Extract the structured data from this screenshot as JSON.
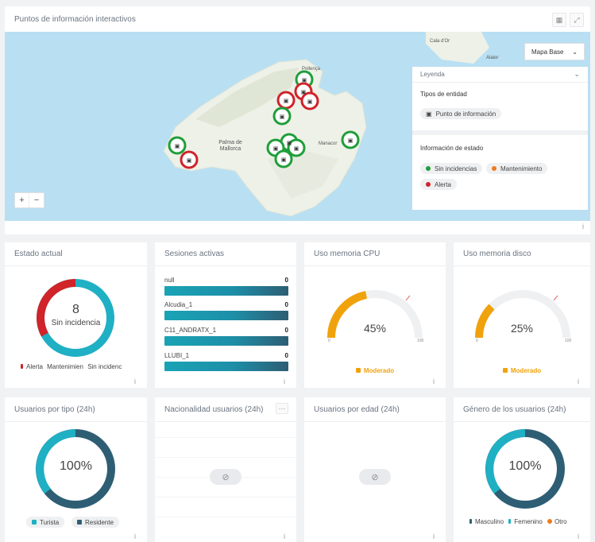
{
  "map_panel": {
    "title": "Puntos de información interactivos",
    "basemap_button": "Mapa Base",
    "zoom_in": "+",
    "zoom_out": "−",
    "info": "i",
    "place_labels": [
      "Cala d'Or",
      "Alaior",
      "Palma de Mallorca",
      "Manacor",
      "Pollença"
    ],
    "legend": {
      "title": "Leyenda",
      "entity_section": "Tipos de entidad",
      "entity_chip": "Punto de información",
      "state_section": "Información de estado",
      "states": [
        {
          "label": "Sin incidencias",
          "color": "#1f9e3a"
        },
        {
          "label": "Mantenimiento",
          "color": "#f07b1c"
        },
        {
          "label": "Alerta",
          "color": "#d0232a"
        }
      ]
    }
  },
  "widgets": {
    "estado": {
      "title": "Estado actual",
      "value": "8",
      "label": "Sin incidencia",
      "legend": [
        "Alerta",
        "Mantenimien",
        "Sin incidenc"
      ],
      "info": "i",
      "slices": [
        {
          "label": "Alerta",
          "fraction": 0.33,
          "color": "#d0232a"
        },
        {
          "label": "Sin incidencias",
          "fraction": 0.67,
          "color": "#1fb0c4"
        }
      ]
    },
    "sesiones": {
      "title": "Sesiones activas",
      "info": "i",
      "rows": [
        {
          "label": "null",
          "value": "0"
        },
        {
          "label": "Alcudia_1",
          "value": "0"
        },
        {
          "label": "C11_ANDRATX_1",
          "value": "0"
        },
        {
          "label": "LLUBI_1",
          "value": "0"
        }
      ]
    },
    "cpu": {
      "title": "Uso memoria CPU",
      "value": "45%",
      "fraction": 0.45,
      "min": "0",
      "max": "100",
      "status": "Moderado",
      "info": "i"
    },
    "disco": {
      "title": "Uso memoria disco",
      "value": "25%",
      "fraction": 0.25,
      "min": "0",
      "max": "100",
      "status": "Moderado",
      "info": "i"
    },
    "usuarios_tipo": {
      "title": "Usuarios por tipo (24h)",
      "value": "100%",
      "legend": [
        "Turista",
        "Residente"
      ],
      "info": "i"
    },
    "nacionalidad": {
      "title": "Nacionalidad usuarios (24h)",
      "menu": "···",
      "info": "i"
    },
    "edad": {
      "title": "Usuarios por edad (24h)",
      "info": "i"
    },
    "genero": {
      "title": "Género de los usuarios (24h)",
      "value": "100%",
      "legend": [
        "Masculino",
        "Femenino",
        "Otro"
      ],
      "info": "i"
    }
  },
  "colors": {
    "accent": "#1fb0c4",
    "dark": "#2e5e74",
    "green": "#1f9e3a",
    "red": "#d0232a",
    "orange": "#f0a20c"
  }
}
